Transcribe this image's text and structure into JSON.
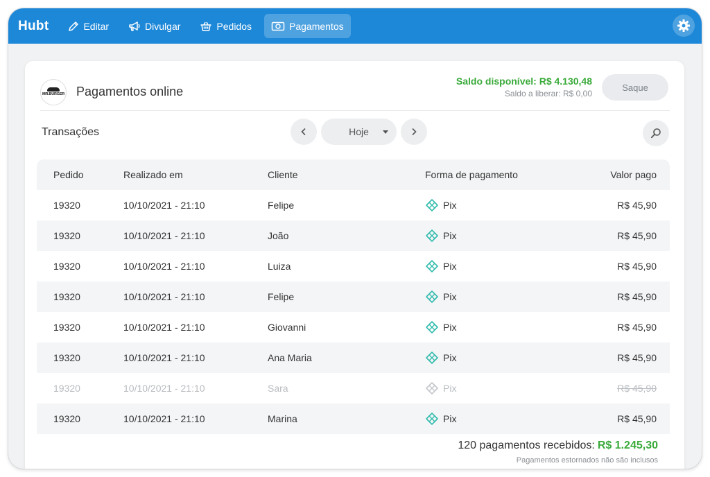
{
  "app": {
    "logo": "Hubt"
  },
  "nav": [
    {
      "label": "Editar",
      "icon": "pencil-icon"
    },
    {
      "label": "Divulgar",
      "icon": "megaphone-icon"
    },
    {
      "label": "Pedidos",
      "icon": "basket-icon"
    },
    {
      "label": "Pagamentos",
      "icon": "money-icon",
      "active": true
    }
  ],
  "header": {
    "brand": "MR.BURGER",
    "title": "Pagamentos online",
    "balance_available": "Saldo disponível: R$ 4.130,48",
    "balance_pending": "Saldo a liberar: R$ 0,00",
    "withdraw_label": "Saque"
  },
  "transactions": {
    "label": "Transações",
    "date_filter": "Hoje",
    "columns": [
      "Pedido",
      "Realizado em",
      "Cliente",
      "Forma de pagamento",
      "Valor pago"
    ],
    "rows": [
      {
        "order": "19320",
        "date": "10/10/2021 - 21:10",
        "client": "Felipe",
        "method": "Pix",
        "value": "R$ 45,90"
      },
      {
        "order": "19320",
        "date": "10/10/2021 - 21:10",
        "client": "João",
        "method": "Pix",
        "value": "R$ 45,90"
      },
      {
        "order": "19320",
        "date": "10/10/2021 - 21:10",
        "client": "Luiza",
        "method": "Pix",
        "value": "R$ 45,90"
      },
      {
        "order": "19320",
        "date": "10/10/2021 - 21:10",
        "client": "Felipe",
        "method": "Pix",
        "value": "R$ 45,90"
      },
      {
        "order": "19320",
        "date": "10/10/2021 - 21:10",
        "client": "Giovanni",
        "method": "Pix",
        "value": "R$ 45,90"
      },
      {
        "order": "19320",
        "date": "10/10/2021 - 21:10",
        "client": "Ana Maria",
        "method": "Pix",
        "value": "R$ 45,90"
      },
      {
        "order": "19320",
        "date": "10/10/2021 - 21:10",
        "client": "Sara",
        "method": "Pix",
        "value": "R$ 45,90",
        "refunded": true
      },
      {
        "order": "19320",
        "date": "10/10/2021 - 21:10",
        "client": "Marina",
        "method": "Pix",
        "value": "R$ 45,90"
      }
    ]
  },
  "summary": {
    "count_label": "120 pagamentos recebidos:",
    "total": "R$ 1.245,30",
    "note": "Pagamentos estornados não são inclusos"
  },
  "colors": {
    "primary": "#1e88d8",
    "success": "#3aaa3a",
    "pix": "#32bcad"
  }
}
